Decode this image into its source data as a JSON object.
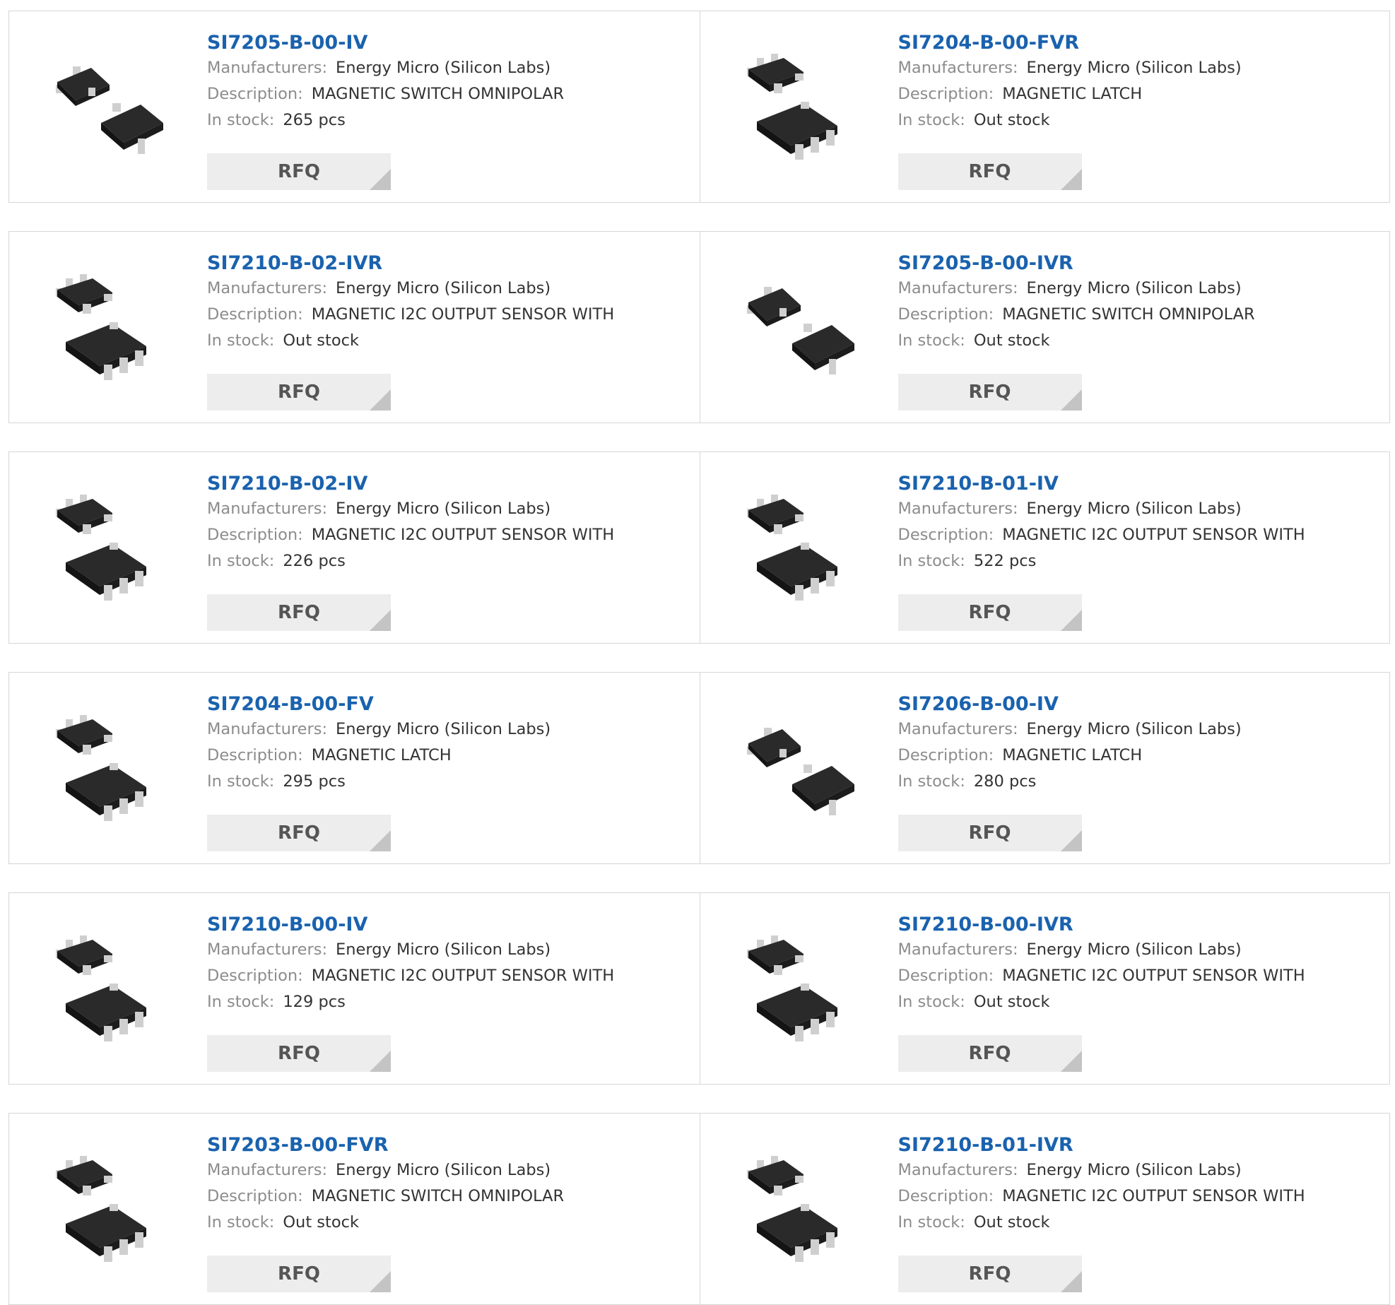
{
  "labels": {
    "manufacturers": "Manufacturers:",
    "description": "Description:",
    "in_stock": "In stock:",
    "rfq": "RFQ"
  },
  "colors": {
    "part_link": "#1a62ae",
    "label_gray": "#8c8c8c",
    "rfq_background": "#ededed",
    "border": "#d6d6d6"
  },
  "products": [
    {
      "part": "SI7205-B-00-IV",
      "manufacturer": "Energy Micro (Silicon Labs)",
      "description": "MAGNETIC SWITCH OMNIPOLAR",
      "stock": "265 pcs",
      "package": "3-pin"
    },
    {
      "part": "SI7204-B-00-FVR",
      "manufacturer": "Energy Micro (Silicon Labs)",
      "description": "MAGNETIC LATCH",
      "stock": "Out stock",
      "package": "5-pin"
    },
    {
      "part": "SI7210-B-02-IVR",
      "manufacturer": "Energy Micro (Silicon Labs)",
      "description": "MAGNETIC I2C OUTPUT SENSOR WITH",
      "stock": "Out stock",
      "package": "5-pin"
    },
    {
      "part": "SI7205-B-00-IVR",
      "manufacturer": "Energy Micro (Silicon Labs)",
      "description": "MAGNETIC SWITCH OMNIPOLAR",
      "stock": "Out stock",
      "package": "3-pin"
    },
    {
      "part": "SI7210-B-02-IV",
      "manufacturer": "Energy Micro (Silicon Labs)",
      "description": "MAGNETIC I2C OUTPUT SENSOR WITH",
      "stock": "226 pcs",
      "package": "5-pin"
    },
    {
      "part": "SI7210-B-01-IV",
      "manufacturer": "Energy Micro (Silicon Labs)",
      "description": "MAGNETIC I2C OUTPUT SENSOR WITH",
      "stock": "522 pcs",
      "package": "5-pin"
    },
    {
      "part": "SI7204-B-00-FV",
      "manufacturer": "Energy Micro (Silicon Labs)",
      "description": "MAGNETIC LATCH",
      "stock": "295 pcs",
      "package": "5-pin"
    },
    {
      "part": "SI7206-B-00-IV",
      "manufacturer": "Energy Micro (Silicon Labs)",
      "description": "MAGNETIC LATCH",
      "stock": "280 pcs",
      "package": "3-pin"
    },
    {
      "part": "SI7210-B-00-IV",
      "manufacturer": "Energy Micro (Silicon Labs)",
      "description": "MAGNETIC I2C OUTPUT SENSOR WITH",
      "stock": "129 pcs",
      "package": "5-pin"
    },
    {
      "part": "SI7210-B-00-IVR",
      "manufacturer": "Energy Micro (Silicon Labs)",
      "description": "MAGNETIC I2C OUTPUT SENSOR WITH",
      "stock": "Out stock",
      "package": "5-pin"
    },
    {
      "part": "SI7203-B-00-FVR",
      "manufacturer": "Energy Micro (Silicon Labs)",
      "description": "MAGNETIC SWITCH OMNIPOLAR",
      "stock": "Out stock",
      "package": "5-pin"
    },
    {
      "part": "SI7210-B-01-IVR",
      "manufacturer": "Energy Micro (Silicon Labs)",
      "description": "MAGNETIC I2C OUTPUT SENSOR WITH",
      "stock": "Out stock",
      "package": "5-pin"
    }
  ]
}
